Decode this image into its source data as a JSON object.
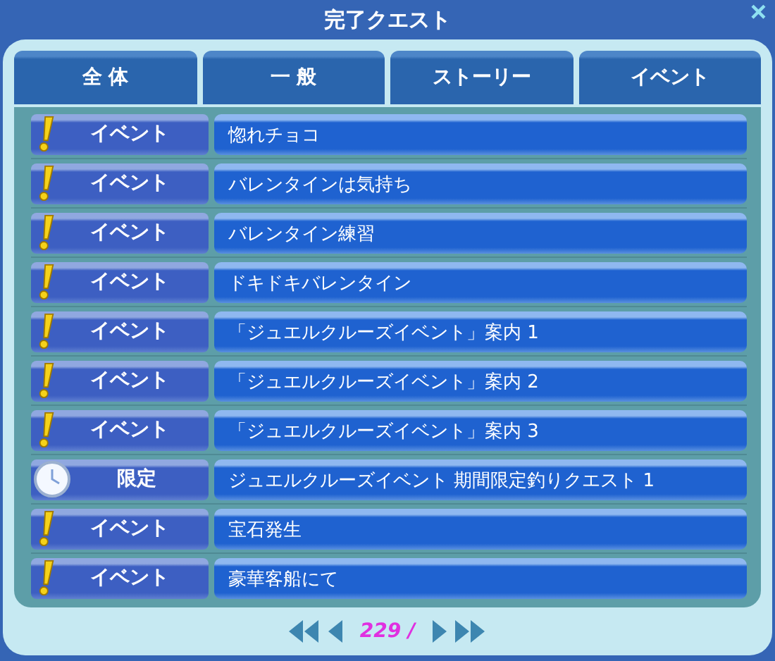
{
  "window": {
    "title": "完了クエスト",
    "close": "×"
  },
  "tabs": [
    {
      "label": "全 体",
      "selected": false
    },
    {
      "label": "一 般",
      "selected": false
    },
    {
      "label": "ストーリー",
      "selected": false
    },
    {
      "label": "イベント",
      "selected": false
    }
  ],
  "quests": [
    {
      "kind": "event",
      "category": "イベント",
      "title": "惚れチョコ"
    },
    {
      "kind": "event",
      "category": "イベント",
      "title": "バレンタインは気持ち"
    },
    {
      "kind": "event",
      "category": "イベント",
      "title": "バレンタイン練習"
    },
    {
      "kind": "event",
      "category": "イベント",
      "title": "ドキドキバレンタイン"
    },
    {
      "kind": "event",
      "category": "イベント",
      "title": "「ジュエルクルーズイベント」案内 1"
    },
    {
      "kind": "event",
      "category": "イベント",
      "title": "「ジュエルクルーズイベント」案内 2"
    },
    {
      "kind": "event",
      "category": "イベント",
      "title": "「ジュエルクルーズイベント」案内 3"
    },
    {
      "kind": "limited",
      "category": "限定",
      "title": "ジュエルクルーズイベント 期間限定釣りクエスト 1"
    },
    {
      "kind": "event",
      "category": "イベント",
      "title": "宝石発生"
    },
    {
      "kind": "event",
      "category": "イベント",
      "title": "豪華客船にて"
    }
  ],
  "pager": {
    "page": "229 /"
  }
}
